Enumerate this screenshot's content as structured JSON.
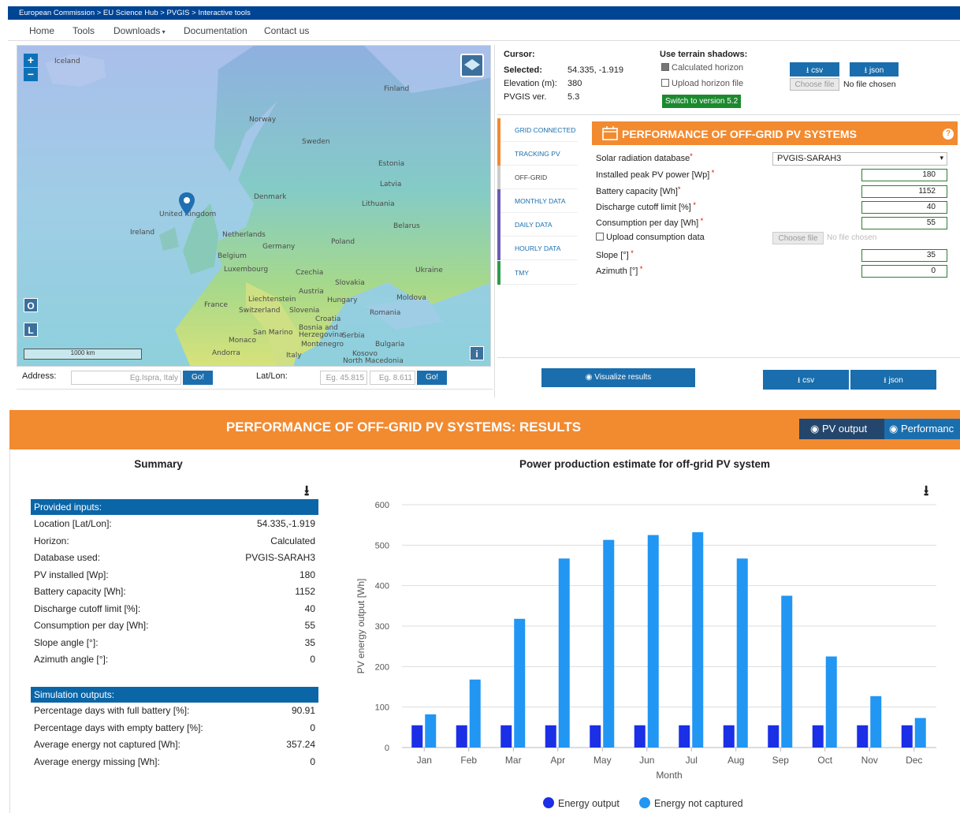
{
  "breadcrumb": "European Commission > EU Science Hub > PVGIS > Interactive tools",
  "nav": {
    "home": "Home",
    "tools": "Tools",
    "downloads": "Downloads",
    "documentation": "Documentation",
    "contact": "Contact us"
  },
  "map": {
    "labels": [
      "Iceland",
      "Finland",
      "Norway",
      "Sweden",
      "Estonia",
      "Latvia",
      "Denmark",
      "Lithuania",
      "United Kingdom",
      "Ireland",
      "Belarus",
      "Netherlands",
      "Poland",
      "Germany",
      "Belgium",
      "Luxembourg",
      "Czechia",
      "Ukraine",
      "Slovakia",
      "Austria",
      "Moldova",
      "Liechtenstein",
      "Hungary",
      "France",
      "Switzerland",
      "Slovenia",
      "Romania",
      "Croatia",
      "Bosnia and Herzegovina",
      "San Marino",
      "Serbia",
      "Monaco",
      "Montenegro",
      "Bulgaria",
      "Andorra",
      "Italy",
      "Kosovo",
      "North Macedonia"
    ],
    "scale": "1000 km",
    "btn_o": "O",
    "btn_l": "L",
    "btn_info": "i"
  },
  "address": {
    "label": "Address:",
    "placeholder": "Eg.Ispra, Italy",
    "go": "Go!",
    "latlon_label": "Lat/Lon:",
    "lat_placeholder": "Eg. 45.815",
    "lon_placeholder": "Eg. 8.611",
    "go2": "Go!"
  },
  "info": {
    "cursor_label": "Cursor:",
    "selected_label": "Selected:",
    "selected_value": "54.335, -1.919",
    "elevation_label": "Elevation (m):",
    "elevation_value": "380",
    "version_label": "PVGIS ver.",
    "version_value": "5.3",
    "terrain_title": "Use terrain shadows:",
    "calc_horizon": "Calculated horizon",
    "upload_horizon": "Upload horizon file",
    "switch_btn": "Switch to version 5.2",
    "csv": "csv",
    "json": "json",
    "choose_file": "Choose file",
    "no_file": "No file chosen"
  },
  "tabs": [
    "GRID CONNECTED",
    "TRACKING PV",
    "OFF-GRID",
    "MONTHLY DATA",
    "DAILY DATA",
    "HOURLY DATA",
    "TMY"
  ],
  "tab_colors": [
    "#f28a30",
    "#f28a30",
    "#cccccc",
    "#6b5bb5",
    "#6b5bb5",
    "#6b5bb5",
    "#2e9a4b"
  ],
  "form": {
    "title": "PERFORMANCE OF OFF-GRID PV SYSTEMS",
    "help": "?",
    "db_label": "Solar radiation database",
    "db_value": "PVGIS-SARAH3",
    "peak_label": "Installed peak PV power [Wp]",
    "peak_value": "180",
    "battery_label": "Battery capacity [Wh]",
    "battery_value": "1152",
    "cutoff_label": "Discharge cutoff limit [%]",
    "cutoff_value": "40",
    "consumption_label": "Consumption per day [Wh]",
    "consumption_value": "55",
    "upload_label": "Upload consumption data",
    "choose_file": "Choose file",
    "no_file": "No file chosen",
    "slope_label": "Slope [°]",
    "slope_value": "35",
    "azimuth_label": "Azimuth [°]",
    "azimuth_value": "0",
    "visualize": "Visualize results",
    "csv": "csv",
    "json": "json"
  },
  "results": {
    "title": "PERFORMANCE OF OFF-GRID PV SYSTEMS: RESULTS",
    "btn_pv_output": "PV output",
    "btn_performance": "Performanc",
    "summary_title": "Summary",
    "provided_inputs": "Provided inputs:",
    "inputs": [
      {
        "label": "Location [Lat/Lon]:",
        "value": "54.335,-1.919"
      },
      {
        "label": "Horizon:",
        "value": "Calculated"
      },
      {
        "label": "Database used:",
        "value": "PVGIS-SARAH3"
      },
      {
        "label": "PV installed [Wp]:",
        "value": "180"
      },
      {
        "label": "Battery capacity [Wh]:",
        "value": "1152"
      },
      {
        "label": "Discharge cutoff limit [%]:",
        "value": "40"
      },
      {
        "label": "Consumption per day [Wh]:",
        "value": "55"
      },
      {
        "label": "Slope angle [°]:",
        "value": "35"
      },
      {
        "label": "Azimuth angle [°]:",
        "value": "0"
      }
    ],
    "simulation_outputs": "Simulation outputs:",
    "outputs": [
      {
        "label": "Percentage days with full battery [%]:",
        "value": "90.91"
      },
      {
        "label": "Percentage days with empty battery [%]:",
        "value": "0"
      },
      {
        "label": "Average energy not captured [Wh]:",
        "value": "357.24"
      },
      {
        "label": "Average energy missing [Wh]:",
        "value": "0"
      }
    ]
  },
  "chart_data": {
    "type": "bar",
    "title": "Power production estimate for off-grid PV system",
    "xlabel": "Month",
    "ylabel": "PV energy output [Wh]",
    "ylim": [
      0,
      600
    ],
    "yticks": [
      0,
      100,
      200,
      300,
      400,
      500,
      600
    ],
    "categories": [
      "Jan",
      "Feb",
      "Mar",
      "Apr",
      "May",
      "Jun",
      "Jul",
      "Aug",
      "Sep",
      "Oct",
      "Nov",
      "Dec"
    ],
    "series": [
      {
        "name": "Energy output",
        "color": "#1a2fe6",
        "values": [
          55,
          55,
          55,
          55,
          55,
          55,
          55,
          55,
          55,
          55,
          55,
          55
        ]
      },
      {
        "name": "Energy not captured",
        "color": "#2196f3",
        "values": [
          82,
          168,
          318,
          467,
          513,
          525,
          532,
          467,
          375,
          225,
          127,
          73
        ]
      }
    ],
    "grid": true,
    "legend": "bottom"
  }
}
